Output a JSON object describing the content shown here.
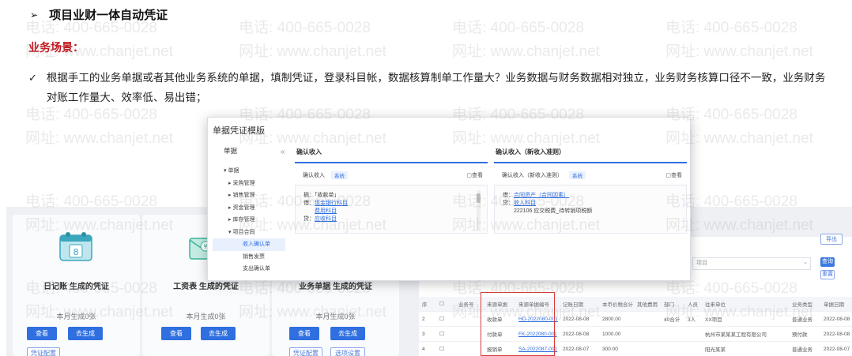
{
  "heading": {
    "arrow": "➢",
    "title": "项目业财一体自动凭证"
  },
  "scenario": {
    "label": "业务场景：",
    "check": "✓",
    "text": "根据手工的业务单据或者其他业务系统的单据，填制凭证，登录科目帐，数据核算制单工作量大？业务数据与财务数据相对独立，业务财务核算口径不一致，业务财务对账工作量大、效率低、易出错；"
  },
  "watermark": {
    "phone": "电话: 400-665-0028",
    "url": "网址: www.chanjet.net"
  },
  "cards": [
    {
      "label": "日记账 生成的凭证",
      "count": "本月生成0张",
      "view": "查看",
      "generate": "去生成",
      "config": "凭证配置",
      "icon": "calendar-icon"
    },
    {
      "label": "工资表 生成的凭证",
      "count": "本月生成0张",
      "view": "查看",
      "generate": "去生成",
      "icon": "envelope-icon"
    },
    {
      "label": "业务单据 生成的凭证",
      "count": "本月生成0张",
      "view": "查看",
      "generate": "去生成",
      "config": "凭证配置",
      "settings": "选项设置"
    }
  ],
  "modal": {
    "title": "单据凭证模版",
    "tree_header": "单据",
    "tree": [
      {
        "label": "▾ 单据",
        "indent": 1
      },
      {
        "label": "▸ 采购管理",
        "indent": 2
      },
      {
        "label": "▸ 销售管理",
        "indent": 2
      },
      {
        "label": "▸ 资金管理",
        "indent": 2
      },
      {
        "label": "▸ 库存管理",
        "indent": 2
      },
      {
        "label": "▾ 项目合同",
        "indent": 2
      },
      {
        "label": "收入确认单",
        "indent": 3,
        "selected": true
      },
      {
        "label": "销售发票",
        "indent": 3
      },
      {
        "label": "支出确认单",
        "indent": 3
      }
    ],
    "left_pane": {
      "header": "确认收入",
      "bar_label": "确认收入",
      "tag": "系统",
      "view": "查看",
      "lines": [
        {
          "prefix": "摘：",
          "text": "「收款单」",
          "link": false
        },
        {
          "prefix": "借：",
          "text": "现金银行科目",
          "link": true
        },
        {
          "prefix": "",
          "text": "费用科目",
          "link": true
        },
        {
          "prefix": "贷：",
          "text": "应收科目",
          "link": true
        }
      ]
    },
    "right_pane": {
      "header": "确认收入（新收入准则）",
      "bar_label": "确认收入（新收入准则）",
      "tag": "系统",
      "view": "查看",
      "lines": [
        {
          "prefix": "借：",
          "text": "合同资产（合同因素）",
          "link": true
        },
        {
          "prefix": "贷：",
          "text": "收入科目",
          "link": true
        },
        {
          "prefix": "",
          "text": "222106 应交税费_待转销项税额",
          "link": false
        }
      ]
    }
  },
  "table": {
    "search_placeholder": "项目",
    "top_button": "导出",
    "search_button": "查询",
    "reset_button": "重置",
    "columns": [
      "序",
      "业务号",
      "来源单据",
      "来源单据编号",
      "记账日期",
      "本币价税合计",
      "其他费用",
      "部门",
      "人员",
      "往来单位",
      "业务类型",
      "单据日期"
    ],
    "rows": [
      [
        "2",
        "",
        "收款单",
        "HD-2022080-001",
        "2022-08-08",
        "2800.00",
        "",
        "40合计",
        "3人",
        "XX项目",
        "普通业务",
        "2022-08-08"
      ],
      [
        "3",
        "",
        "付款单",
        "FK-2022080-001",
        "2022-08-08",
        "1000.00",
        "",
        "",
        "",
        "杭州市某某某工程有限公司",
        "预付款",
        "2022-08-08"
      ],
      [
        "4",
        "",
        "报销单",
        "SA-2022087-001",
        "2022-08-07",
        "300.00",
        "",
        "",
        "",
        "阳光某某",
        "普通业务",
        "2022-08-07"
      ]
    ]
  },
  "colors": {
    "accent": "#2f6fe0",
    "red": "#c0161e"
  }
}
